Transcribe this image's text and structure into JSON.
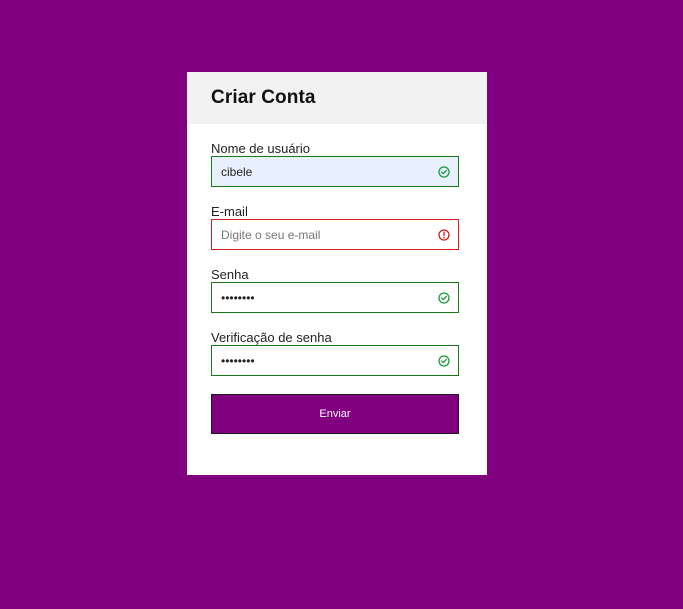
{
  "theme": {
    "background": "#800080",
    "success": "#1a7a1a",
    "error": "#d81b1b",
    "button_bg": "#800080"
  },
  "card": {
    "title": "Criar Conta"
  },
  "form": {
    "username": {
      "label": "Nome de usuário",
      "value": "cibele",
      "placeholder": "",
      "status": "success",
      "icon": "check-circle-icon"
    },
    "email": {
      "label": "E-mail",
      "value": "",
      "placeholder": "Digite o seu e-mail",
      "status": "error",
      "icon": "exclamation-circle-icon"
    },
    "password": {
      "label": "Senha",
      "value": "12345678",
      "placeholder": "",
      "status": "success",
      "icon": "check-circle-icon"
    },
    "password_check": {
      "label": "Verificação de senha",
      "value": "12345678",
      "placeholder": "",
      "status": "success",
      "icon": "check-circle-icon"
    },
    "submit_label": "Enviar"
  }
}
